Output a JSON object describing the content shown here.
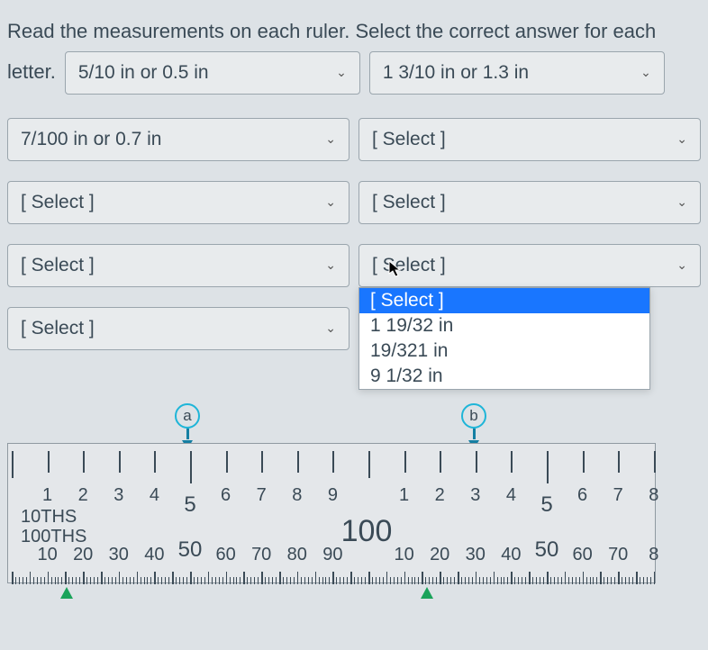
{
  "question": {
    "line1": "Read the measurements on each ruler. Select the correct answer for each",
    "lead_word": "letter."
  },
  "dropdowns": {
    "a": "5/10 in or 0.5 in",
    "b": "1 3/10 in or 1.3 in",
    "c": "7/100 in or 0.7 in",
    "d": "[ Select ]",
    "e": "[ Select ]",
    "f": "[ Select ]",
    "g": "[ Select ]",
    "h": "[ Select ]",
    "i": "[ Select ]"
  },
  "open_dropdown": {
    "options": [
      "[ Select ]",
      "1 19/32 in",
      "19/321 in",
      "9 1/32 in"
    ],
    "highlighted_index": 0
  },
  "ruler": {
    "markers": {
      "a": "a",
      "b": "b"
    },
    "scale_labels": {
      "tenths": "10THS",
      "hundredths": "100THS",
      "one_hundred": "100"
    },
    "tenths_numbers_left": [
      "1",
      "2",
      "3",
      "4",
      "5",
      "6",
      "7",
      "8",
      "9"
    ],
    "tenths_numbers_right": [
      "1",
      "2",
      "3",
      "4",
      "5",
      "6",
      "7",
      "8"
    ],
    "hundredths_numbers_left": [
      "10",
      "20",
      "30",
      "40",
      "50",
      "60",
      "70",
      "80",
      "90"
    ],
    "hundredths_numbers_right": [
      "10",
      "20",
      "30",
      "40",
      "50",
      "60",
      "70",
      "8"
    ]
  }
}
